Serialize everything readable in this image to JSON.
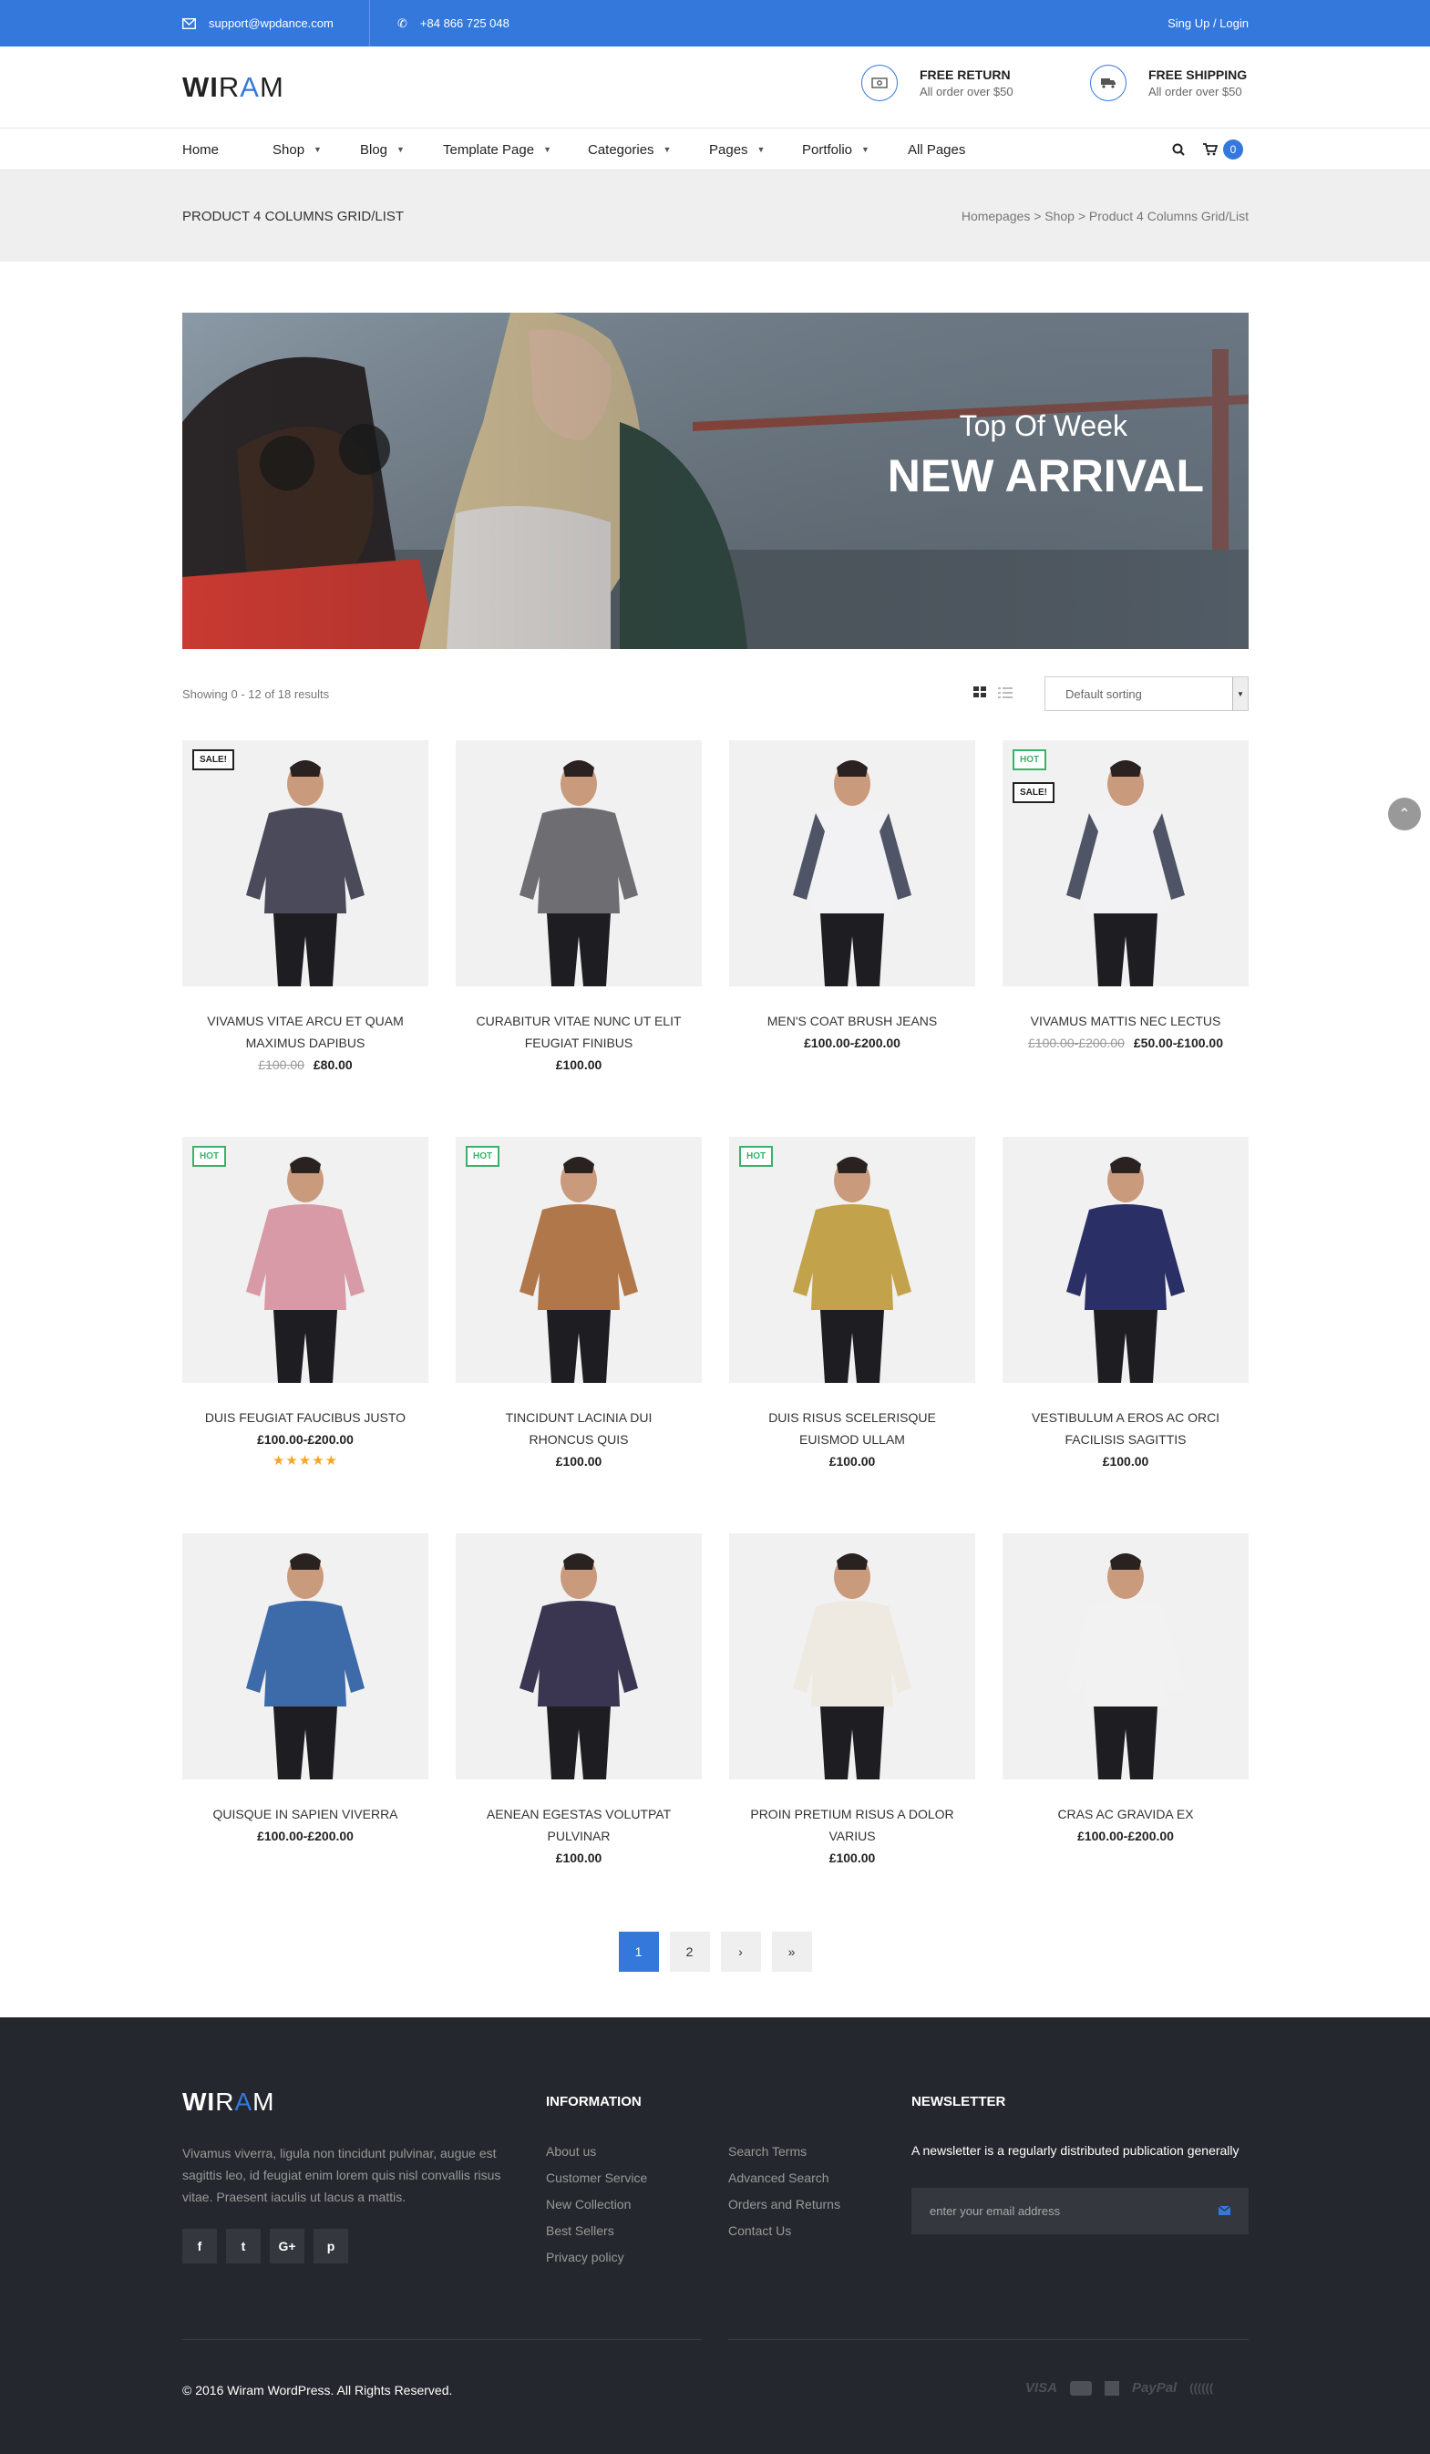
{
  "topbar": {
    "email": "support@wpdance.com",
    "phone": "+84 866 725 048",
    "signup": "Sing Up / Login"
  },
  "logo": {
    "part1": "WI",
    "part2": "R",
    "part3": "A",
    "part4": "M"
  },
  "features": [
    {
      "title": "FREE RETURN",
      "subtitle": "All order over $50",
      "icon": "money-icon"
    },
    {
      "title": "FREE SHIPPING",
      "subtitle": "All order over $50",
      "icon": "truck-icon"
    }
  ],
  "nav": {
    "items": [
      "Home",
      "Shop",
      "Blog",
      "Template Page",
      "Categories",
      "Pages",
      "Portfolio",
      "All Pages"
    ],
    "cart_count": "0"
  },
  "page": {
    "title": "PRODUCT 4 COLUMNS GRID/LIST",
    "breadcrumb": "Homepages > Shop > Product 4 Columns Grid/List"
  },
  "banner": {
    "subtitle": "Top Of Week",
    "title": "NEW ARRIVAL"
  },
  "results": {
    "count_text": "Showing 0 - 12 of 18 results",
    "sort": "Default sorting"
  },
  "products": [
    {
      "name": "Vivamus vitae arcu et quam maximus dapibus",
      "old": "£100.00",
      "price": "£80.00",
      "badges": [
        "SALE!"
      ]
    },
    {
      "name": "Curabitur vitae nunc ut elit feugiat finibus",
      "old": "",
      "price": "£100.00",
      "badges": []
    },
    {
      "name": "Men's coat brush jeans",
      "old": "",
      "price": "£100.00-£200.00",
      "badges": []
    },
    {
      "name": "Vivamus mattis nec lectus",
      "old": "£100.00-£200.00",
      "price": "£50.00-£100.00",
      "badges": [
        "HOT",
        "SALE!"
      ]
    },
    {
      "name": "Duis feugiat faucibus justo",
      "old": "",
      "price": "£100.00-£200.00",
      "badges": [
        "HOT"
      ],
      "stars": "★★★★★"
    },
    {
      "name": "Tincidunt lacinia dui rhoncus quis",
      "old": "",
      "price": "£100.00",
      "badges": [
        "HOT"
      ]
    },
    {
      "name": "Duis risus scelerisque euismod ullam",
      "old": "",
      "price": "£100.00",
      "badges": [
        "HOT"
      ]
    },
    {
      "name": "Vestibulum a eros ac orci facilisis sagittis",
      "old": "",
      "price": "£100.00",
      "badges": []
    },
    {
      "name": "Quisque in sapien viverra",
      "old": "",
      "price": "£100.00-£200.00",
      "badges": []
    },
    {
      "name": "Aenean egestas volutpat pulvinar",
      "old": "",
      "price": "£100.00",
      "badges": []
    },
    {
      "name": "Proin pretium risus a dolor varius",
      "old": "",
      "price": "£100.00",
      "badges": []
    },
    {
      "name": "Cras ac gravida ex",
      "old": "",
      "price": "£100.00-£200.00",
      "badges": []
    }
  ],
  "pagination": [
    "1",
    "2",
    "›",
    "»"
  ],
  "footer": {
    "about": "Vivamus viverra, ligula non tincidunt pulvinar, augue est sagittis leo, id feugiat enim lorem quis nisl convallis risus vitae. Praesent iaculis ut lacus a mattis.",
    "info_title": "INFORMATION",
    "info_col1": [
      "About us",
      "Customer Service",
      "New Collection",
      "Best Sellers",
      "Privacy policy"
    ],
    "info_col2": [
      "Search Terms",
      "Advanced Search",
      "Orders and Returns",
      "Contact Us"
    ],
    "newsletter_title": "NEWSLETTER",
    "newsletter_text": "A newsletter is a regularly distributed publication generally",
    "email_placeholder": "enter your email address",
    "social": [
      "f",
      "t",
      "G+",
      "p"
    ],
    "copyright": "© 2016 Wiram WordPress. All Rights Reserved.",
    "payments": [
      "VISA",
      "PayPal"
    ]
  },
  "colors": {
    "accent": "#3478dc",
    "footer": "#24272d",
    "hot": "#3ab26b"
  }
}
